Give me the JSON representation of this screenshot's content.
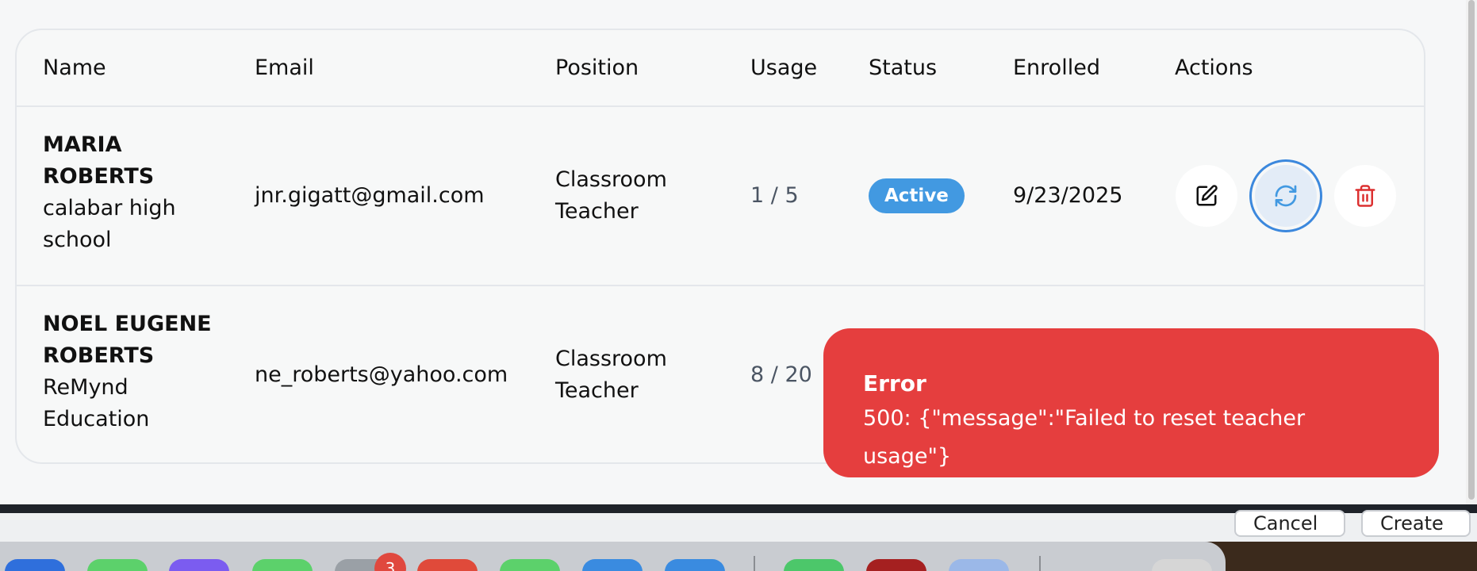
{
  "table": {
    "headers": {
      "name": "Name",
      "email": "Email",
      "position": "Position",
      "usage": "Usage",
      "status": "Status",
      "enrolled": "Enrolled",
      "actions": "Actions"
    },
    "rows": [
      {
        "name_line1": "MARIA",
        "name_line2": "ROBERTS",
        "school_line1": "calabar high",
        "school_line2": "school",
        "email": "jnr.gigatt@gmail.com",
        "position_line1": "Classroom",
        "position_line2": "Teacher",
        "usage": "1 / 5",
        "status": "Active",
        "enrolled": "9/23/2025"
      },
      {
        "name_line1": "NOEL EUGENE",
        "name_line2": "ROBERTS",
        "school_line1": "ReMynd",
        "school_line2": "Education",
        "email": "ne_roberts@yahoo.com",
        "position_line1": "Classroom",
        "position_line2": "Teacher",
        "usage": "8 / 20"
      }
    ],
    "action_icons": [
      "edit-icon",
      "refresh-icon",
      "trash-icon"
    ]
  },
  "toast": {
    "title": "Error",
    "message": "500: {\"message\":\"Failed to reset teacher usage\"}"
  },
  "background_dialog": {
    "cancel_label": "Cancel",
    "create_label": "Create"
  },
  "dock": {
    "badge_count": "3"
  },
  "colors": {
    "accent": "#4299e1",
    "error": "#e53e3e",
    "delete": "#dc3030",
    "focus_ring": "#3c88dd"
  }
}
